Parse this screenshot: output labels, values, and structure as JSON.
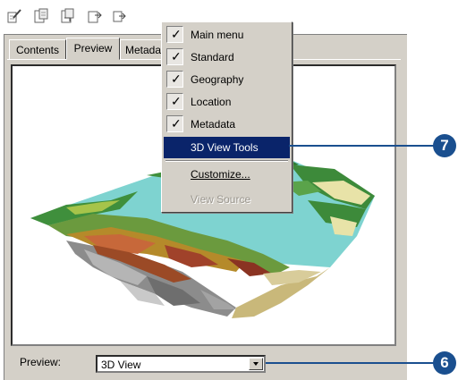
{
  "tabs": [
    "Contents",
    "Preview",
    "Metadata"
  ],
  "context_menu": {
    "items": [
      {
        "label": "Main menu",
        "checked": true
      },
      {
        "label": "Standard",
        "checked": true
      },
      {
        "label": "Geography",
        "checked": true
      },
      {
        "label": "Location",
        "checked": true
      },
      {
        "label": "Metadata",
        "checked": true
      },
      {
        "label": "3D View Tools",
        "checked": false,
        "selected": true
      }
    ],
    "customize": "Customize...",
    "view_source": "View Source"
  },
  "preview": {
    "label": "Preview:",
    "value": "3D View"
  },
  "callouts": {
    "menu_item": "7",
    "preview_select": "6"
  },
  "colors": {
    "selection": "#0a246a",
    "callout": "#1a4f8f",
    "water": "#7ed3d0"
  }
}
